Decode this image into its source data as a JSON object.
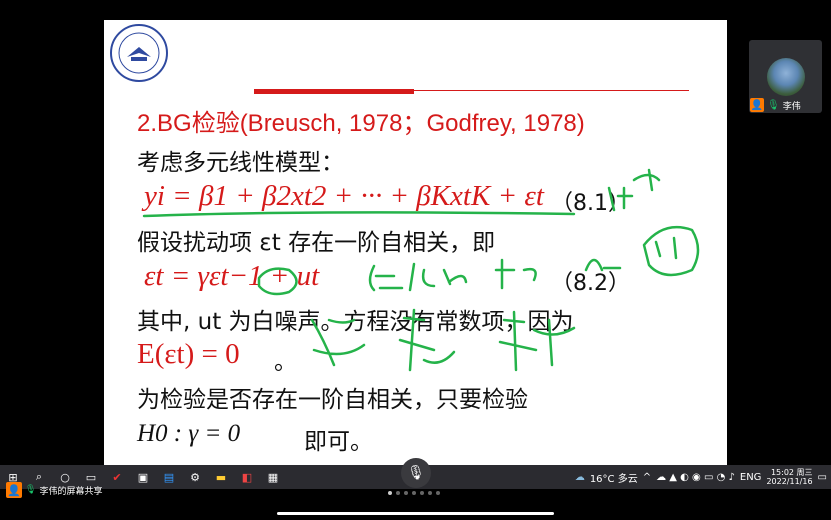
{
  "slide": {
    "title": "2.BG检验(Breusch, 1978；Godfrey, 1978)",
    "line_consider": "考虑多元线性模型：",
    "eq1": "yi = β1 + β2xt2 + ··· + βKxtK + εt",
    "eq1_num": "（8.1）",
    "line_assume": "假设扰动项 εt 存在一阶自相关，即",
    "eq2": "εt = γεt−1 + ut",
    "eq2_num": "（8.2）",
    "line_where": "其中, ut 为白噪声。方程没有常数项，因为",
    "eq3": "E(εt) = 0",
    "eq3_suffix": "。",
    "line_test": "为检验是否存在一阶自相关，只要检验",
    "hypothesis": "H0 : γ = 0",
    "hypothesis_suffix": "即可。"
  },
  "video": {
    "participant_name": "李伟"
  },
  "share": {
    "label": "李伟的屏幕共享"
  },
  "taskbar": {
    "weather": "16°C 多云",
    "lang": "ENG",
    "time": "15:02 周三",
    "date": "2022/11/16"
  },
  "colors": {
    "title_red": "#d51a1a",
    "ink_green": "#25b34a"
  }
}
